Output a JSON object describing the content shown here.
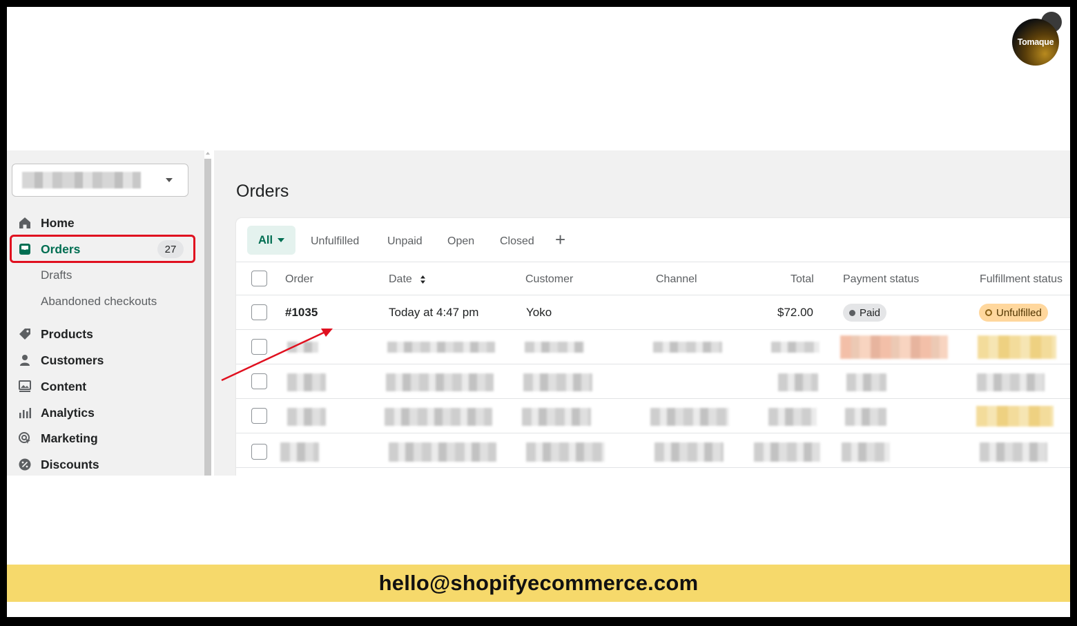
{
  "brand": {
    "logo_text": "Tomaque"
  },
  "sidebar": {
    "nav": {
      "home": "Home",
      "orders": "Orders",
      "orders_count": "27",
      "drafts": "Drafts",
      "abandoned": "Abandoned checkouts",
      "products": "Products",
      "customers": "Customers",
      "content": "Content",
      "analytics": "Analytics",
      "marketing": "Marketing",
      "discounts": "Discounts"
    }
  },
  "page": {
    "title": "Orders"
  },
  "tabs": {
    "all": "All",
    "unfulfilled": "Unfulfilled",
    "unpaid": "Unpaid",
    "open": "Open",
    "closed": "Closed",
    "add": "+"
  },
  "table": {
    "headers": {
      "order": "Order",
      "date": "Date",
      "customer": "Customer",
      "channel": "Channel",
      "total": "Total",
      "payment": "Payment status",
      "fulfillment": "Fulfillment status"
    },
    "rows": [
      {
        "order": "#1035",
        "date": "Today at 4:47 pm",
        "customer": "Yoko",
        "channel": "",
        "total": "$72.00",
        "payment": "Paid",
        "fulfillment": "Unfulfilled"
      }
    ]
  },
  "footer": {
    "email": "hello@shopifyecommerce.com"
  },
  "colors": {
    "accent_green": "#006e52",
    "highlight_red": "#e0101f",
    "footer_yellow": "#f6d96b",
    "paid_badge": "#e4e5e7",
    "unfulfilled_badge": "#ffd79d"
  }
}
